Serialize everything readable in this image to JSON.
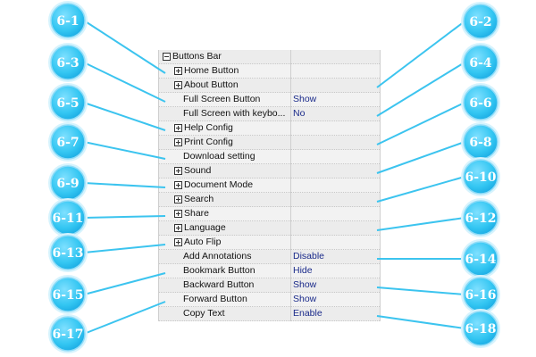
{
  "tree": {
    "rows": [
      {
        "label": "Buttons Bar",
        "value": "",
        "expander": "minus",
        "indent": 0
      },
      {
        "label": "Home Button",
        "value": "",
        "expander": "plus",
        "indent": 1
      },
      {
        "label": "About Button",
        "value": "",
        "expander": "plus",
        "indent": 1
      },
      {
        "label": "Full Screen Button",
        "value": "Show",
        "expander": "none",
        "indent": 1
      },
      {
        "label": "Full Screen with keybo...",
        "value": "No",
        "expander": "none",
        "indent": 1
      },
      {
        "label": "Help Config",
        "value": "",
        "expander": "plus",
        "indent": 1
      },
      {
        "label": "Print Config",
        "value": "",
        "expander": "plus",
        "indent": 1
      },
      {
        "label": "Download setting",
        "value": "",
        "expander": "none",
        "indent": 1
      },
      {
        "label": "Sound",
        "value": "",
        "expander": "plus",
        "indent": 1
      },
      {
        "label": "Document Mode",
        "value": "",
        "expander": "plus",
        "indent": 1
      },
      {
        "label": "Search",
        "value": "",
        "expander": "plus",
        "indent": 1
      },
      {
        "label": "Share",
        "value": "",
        "expander": "plus",
        "indent": 1
      },
      {
        "label": "Language",
        "value": "",
        "expander": "plus",
        "indent": 1
      },
      {
        "label": "Auto Flip",
        "value": "",
        "expander": "plus",
        "indent": 1
      },
      {
        "label": "Add Annotations",
        "value": "Disable",
        "expander": "none",
        "indent": 1
      },
      {
        "label": "Bookmark Button",
        "value": "Hide",
        "expander": "none",
        "indent": 1
      },
      {
        "label": "Backward Button",
        "value": "Show",
        "expander": "none",
        "indent": 1
      },
      {
        "label": "Forward Button",
        "value": "Show",
        "expander": "none",
        "indent": 1
      },
      {
        "label": "Copy Text",
        "value": "Enable",
        "expander": "none",
        "indent": 1
      }
    ]
  },
  "callouts": [
    {
      "label": "6-1",
      "target_row": 1
    },
    {
      "label": "6-2",
      "target_row": 2
    },
    {
      "label": "6-3",
      "target_row": 3
    },
    {
      "label": "6-4",
      "target_row": 4
    },
    {
      "label": "6-5",
      "target_row": 5
    },
    {
      "label": "6-6",
      "target_row": 6
    },
    {
      "label": "6-7",
      "target_row": 7
    },
    {
      "label": "6-8",
      "target_row": 8
    },
    {
      "label": "6-9",
      "target_row": 9
    },
    {
      "label": "6-10",
      "target_row": 10
    },
    {
      "label": "6-11",
      "target_row": 11
    },
    {
      "label": "6-12",
      "target_row": 12
    },
    {
      "label": "6-13",
      "target_row": 13
    },
    {
      "label": "6-14",
      "target_row": 14
    },
    {
      "label": "6-15",
      "target_row": 15
    },
    {
      "label": "6-16",
      "target_row": 16
    },
    {
      "label": "6-17",
      "target_row": 17
    },
    {
      "label": "6-18",
      "target_row": 18
    }
  ],
  "colors": {
    "bubble_fill": "#33c6f2",
    "bubble_stroke": "#8fdcf8",
    "line": "#3cc4ef",
    "value_text": "#1a2a8a"
  }
}
